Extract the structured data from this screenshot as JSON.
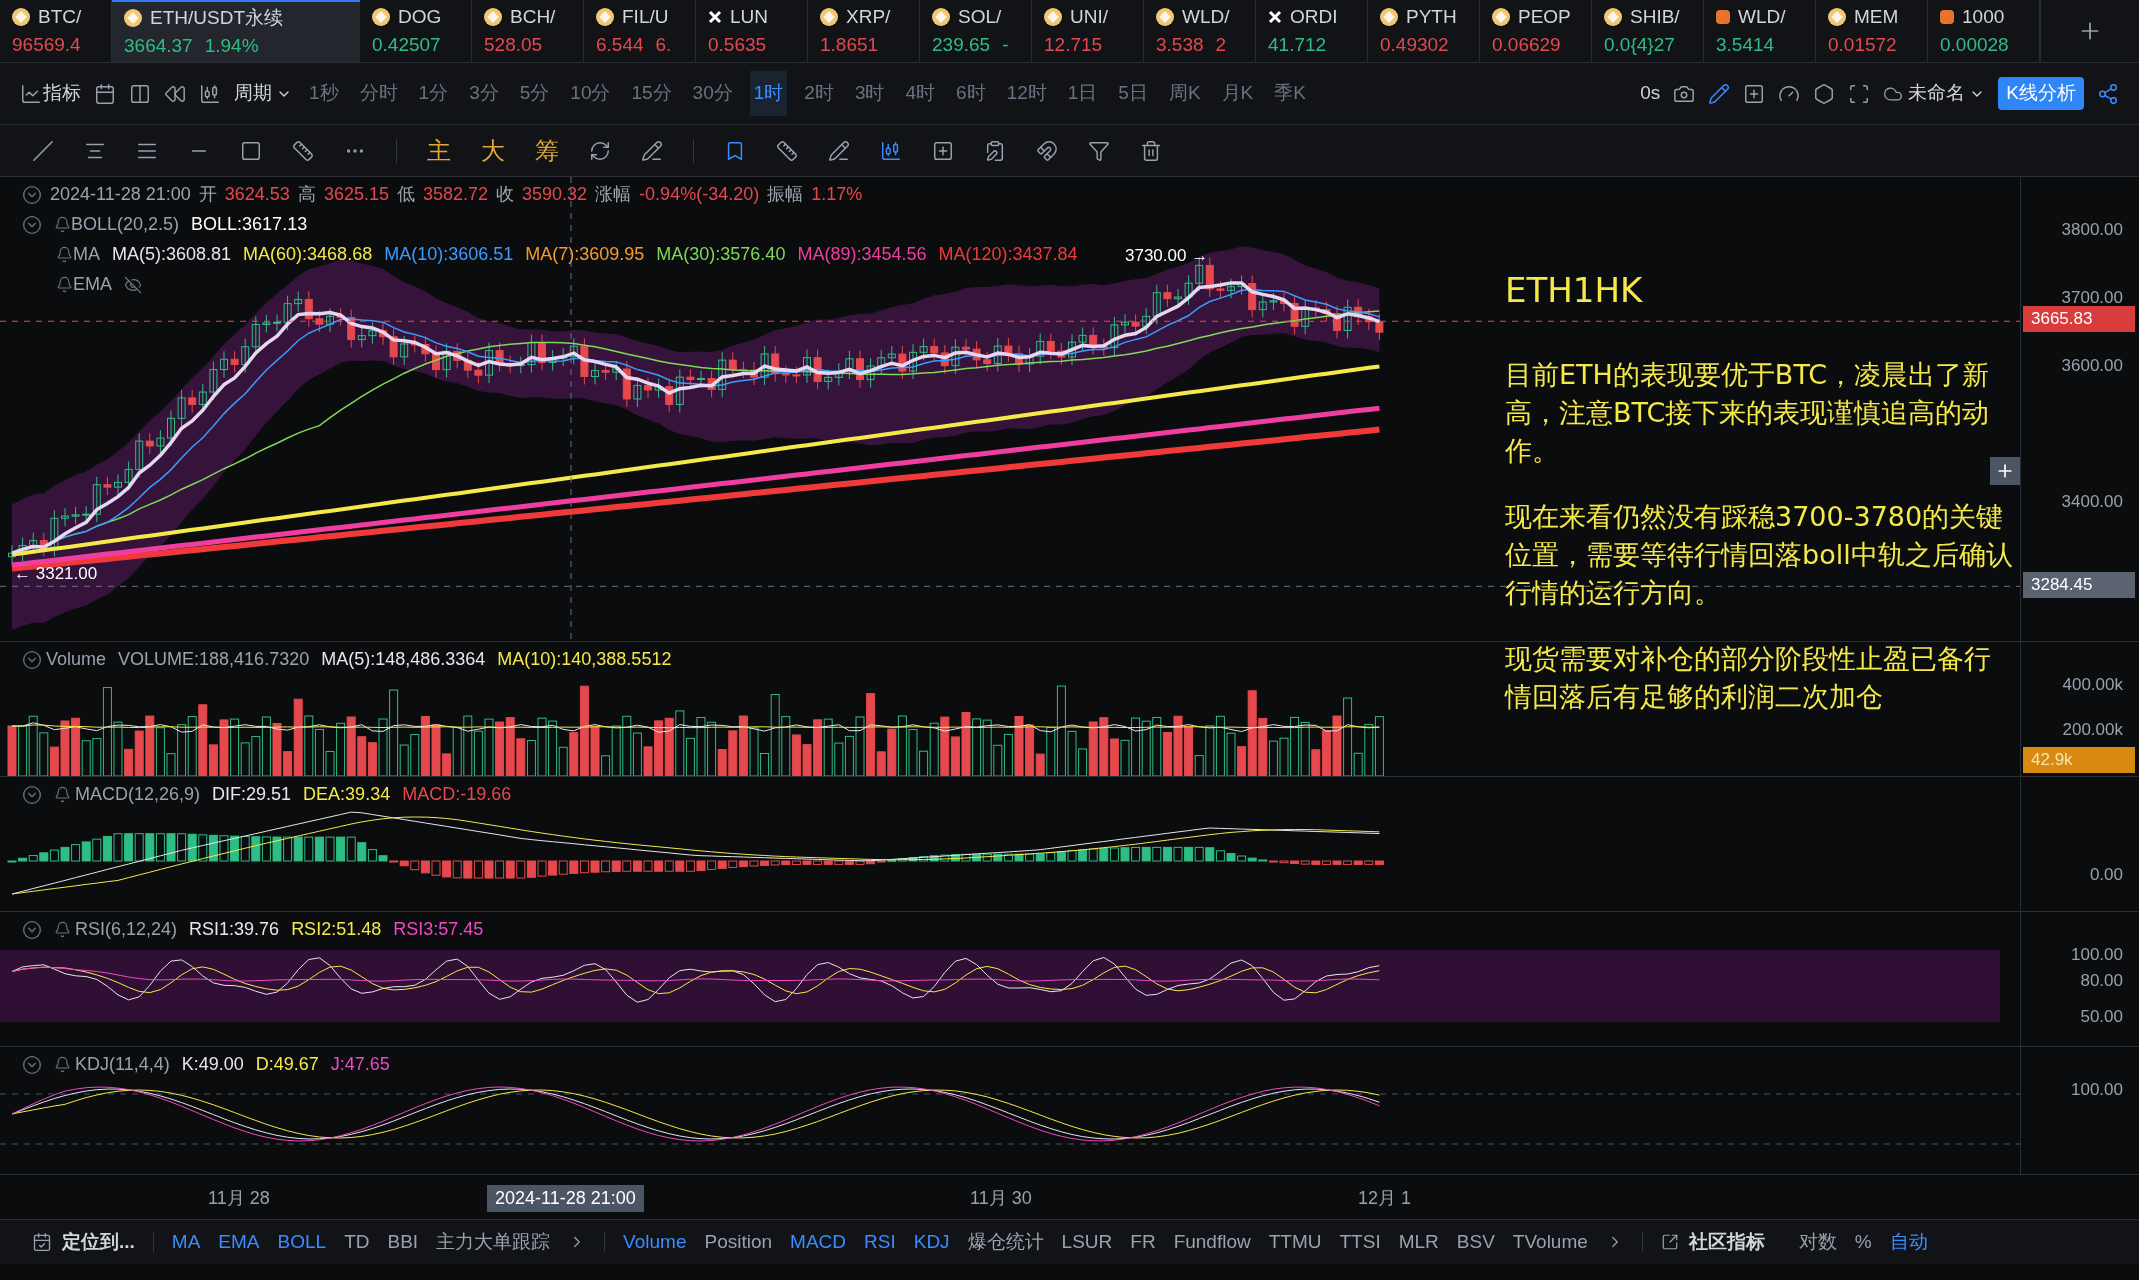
{
  "tickers": [
    {
      "symbol": "BTC/",
      "price": "96569.4",
      "rising": false,
      "kind": "coin",
      "selected": false
    },
    {
      "symbol": "ETH/USDT永续",
      "price": "3664.37",
      "change": "1.94%",
      "rising": true,
      "kind": "coin",
      "selected": true
    },
    {
      "symbol": "DOG",
      "price": "0.42507",
      "rising": true,
      "kind": "coin",
      "selected": false
    },
    {
      "symbol": "BCH/",
      "price": "528.05",
      "rising": false,
      "kind": "coin",
      "selected": false
    },
    {
      "symbol": "FIL/U",
      "price": "6.544",
      "change": "6.",
      "rising": false,
      "kind": "coin",
      "selected": false
    },
    {
      "symbol": "LUN",
      "price": "0.5635",
      "rising": false,
      "kind": "cross",
      "selected": false
    },
    {
      "symbol": "XRP/",
      "price": "1.8651",
      "rising": false,
      "kind": "coin",
      "selected": false
    },
    {
      "symbol": "SOL/",
      "price": "239.65",
      "change": "-",
      "rising": true,
      "kind": "coin",
      "selected": false
    },
    {
      "symbol": "UNI/",
      "price": "12.715",
      "rising": false,
      "kind": "coin",
      "selected": false
    },
    {
      "symbol": "WLD/",
      "price": "3.538",
      "change": "2",
      "rising": false,
      "kind": "coin",
      "selected": false
    },
    {
      "symbol": "ORDI",
      "price": "41.712",
      "rising": true,
      "kind": "cross",
      "selected": false
    },
    {
      "symbol": "PYTH",
      "price": "0.49302",
      "rising": false,
      "kind": "coin",
      "selected": false
    },
    {
      "symbol": "PEOP",
      "price": "0.06629",
      "rising": false,
      "kind": "coin",
      "selected": false
    },
    {
      "symbol": "SHIB/",
      "price": "0.0{4}27",
      "rising": true,
      "kind": "coin",
      "selected": false
    },
    {
      "symbol": "WLD/",
      "price": "3.5414",
      "rising": true,
      "kind": "square",
      "selected": false
    },
    {
      "symbol": "MEM",
      "price": "0.01572",
      "rising": false,
      "kind": "coin",
      "selected": false
    },
    {
      "symbol": "1000",
      "price": "0.00028",
      "rising": true,
      "kind": "square",
      "selected": false
    }
  ],
  "toolbar": {
    "indicators": "指标",
    "period": "周期",
    "periods": [
      {
        "label": "1秒",
        "selected": false
      },
      {
        "label": "分时",
        "selected": false
      },
      {
        "label": "1分",
        "selected": false
      },
      {
        "label": "3分",
        "selected": false
      },
      {
        "label": "5分",
        "selected": false
      },
      {
        "label": "10分",
        "selected": false
      },
      {
        "label": "15分",
        "selected": false
      },
      {
        "label": "30分",
        "selected": false
      },
      {
        "label": "1时",
        "selected": true
      },
      {
        "label": "2时",
        "selected": false
      },
      {
        "label": "3时",
        "selected": false
      },
      {
        "label": "4时",
        "selected": false
      },
      {
        "label": "6时",
        "selected": false
      },
      {
        "label": "12时",
        "selected": false
      },
      {
        "label": "1日",
        "selected": false
      },
      {
        "label": "5日",
        "selected": false
      },
      {
        "label": "周K",
        "selected": false
      },
      {
        "label": "月K",
        "selected": false
      },
      {
        "label": "季K",
        "selected": false
      }
    ],
    "countdown": "0s",
    "layout_name": "未命名",
    "analysis_button": "K线分析"
  },
  "drawing_tools": {
    "text_tools": [
      "主",
      "大",
      "筹"
    ]
  },
  "main_pane": {
    "ohlc": [
      {
        "text": "2024-11-28 21:00",
        "color": "#9ca3af"
      },
      {
        "text": "开",
        "color": "#9ca3af"
      },
      {
        "text": "3624.53",
        "color": "#e5484d"
      },
      {
        "text": "高",
        "color": "#9ca3af"
      },
      {
        "text": "3625.15",
        "color": "#e5484d"
      },
      {
        "text": "低",
        "color": "#9ca3af"
      },
      {
        "text": "3582.72",
        "color": "#e5484d"
      },
      {
        "text": "收",
        "color": "#9ca3af"
      },
      {
        "text": "3590.32",
        "color": "#e5484d"
      },
      {
        "text": "涨幅",
        "color": "#9ca3af"
      },
      {
        "text": "-0.94%(-34.20)",
        "color": "#e5484d"
      },
      {
        "text": "振幅",
        "color": "#9ca3af"
      },
      {
        "text": "1.17%",
        "color": "#e5484d"
      }
    ],
    "boll": {
      "name": "BOLL(20,2.5)",
      "value": "BOLL:3617.13"
    },
    "ma": {
      "name": "MA",
      "values": [
        {
          "text": "MA(5):3608.81",
          "color": "#e5e7eb"
        },
        {
          "text": "MA(60):3468.68",
          "color": "#f5e94a"
        },
        {
          "text": "MA(10):3606.51",
          "color": "#3b9bff"
        },
        {
          "text": "MA(7):3609.95",
          "color": "#f59a2e"
        },
        {
          "text": "MA(30):3576.40",
          "color": "#7ed957"
        },
        {
          "text": "MA(89):3454.56",
          "color": "#f03ea0"
        },
        {
          "text": "MA(120):3437.84",
          "color": "#f03a3a"
        }
      ]
    },
    "ema": {
      "name": "EMA"
    },
    "high_marker": "3730.00 →",
    "low_marker": "← 3321.00",
    "symbol_note": "ETH1HK",
    "notes": [
      "目前ETH的表现要优于BTC，凌晨出了新高，注意BTC接下来的表现谨慎追高的动作。",
      "现在来看仍然没有踩稳3700-3780的关键位置，需要等待行情回落boll中轨之后确认行情的运行方向。",
      "现货需要对补仓的部分阶段性止盈已备行情回落后有足够的利润二次加仓"
    ],
    "axis": [
      "3800.00",
      "3700.00",
      "3600.00",
      "3400.00"
    ],
    "last_price": "3665.83",
    "cursor_price": "3284.45"
  },
  "volume_pane": {
    "name": "Volume",
    "values": [
      {
        "text": "VOLUME:188,416.7320",
        "color": "#9ca3af"
      },
      {
        "text": "MA(5):148,486.3364",
        "color": "#e5e7eb"
      },
      {
        "text": "MA(10):140,388.5512",
        "color": "#f5e94a"
      }
    ],
    "axis": [
      "400.00k",
      "200.00k"
    ],
    "last": "42.9k"
  },
  "macd_pane": {
    "name": "MACD(12,26,9)",
    "values": [
      {
        "text": "DIF:29.51",
        "color": "#e5e7eb"
      },
      {
        "text": "DEA:39.34",
        "color": "#f5e94a"
      },
      {
        "text": "MACD:-19.66",
        "color": "#e5484d"
      }
    ],
    "axis": [
      "0.00"
    ]
  },
  "rsi_pane": {
    "name": "RSI(6,12,24)",
    "values": [
      {
        "text": "RSI1:39.76",
        "color": "#e5e7eb"
      },
      {
        "text": "RSI2:51.48",
        "color": "#f5e94a"
      },
      {
        "text": "RSI3:57.45",
        "color": "#f048c8"
      }
    ],
    "axis": [
      "100.00",
      "80.00",
      "50.00"
    ]
  },
  "kdj_pane": {
    "name": "KDJ(11,4,4)",
    "values": [
      {
        "text": "K:49.00",
        "color": "#e5e7eb"
      },
      {
        "text": "D:49.67",
        "color": "#f5e94a"
      },
      {
        "text": "J:47.65",
        "color": "#f048c8"
      }
    ],
    "axis": [
      "100.00"
    ]
  },
  "time_axis": [
    {
      "label": "11月 28",
      "selected": false
    },
    {
      "label": "2024-11-28 21:00",
      "selected": true
    },
    {
      "label": "11月 30",
      "selected": false
    },
    {
      "label": "12月 1",
      "selected": false
    }
  ],
  "bottom_bar": {
    "locate": "定位到...",
    "main_indicators": [
      {
        "label": "MA",
        "active": true
      },
      {
        "label": "EMA",
        "active": true
      },
      {
        "label": "BOLL",
        "active": true
      },
      {
        "label": "TD",
        "active": false
      },
      {
        "label": "BBI",
        "active": false
      },
      {
        "label": "主力大单跟踪",
        "active": false
      }
    ],
    "sub_indicators": [
      {
        "label": "Volume",
        "active": true
      },
      {
        "label": "Position",
        "active": false
      },
      {
        "label": "MACD",
        "active": true
      },
      {
        "label": "RSI",
        "active": true
      },
      {
        "label": "KDJ",
        "active": true
      },
      {
        "label": "爆仓统计",
        "active": false
      },
      {
        "label": "LSUR",
        "active": false
      },
      {
        "label": "FR",
        "active": false
      },
      {
        "label": "Fundflow",
        "active": false
      },
      {
        "label": "TTMU",
        "active": false
      },
      {
        "label": "TTSI",
        "active": false
      },
      {
        "label": "MLR",
        "active": false
      },
      {
        "label": "BSV",
        "active": false
      },
      {
        "label": "TVolume",
        "active": false
      }
    ],
    "community": "社区指标",
    "log": "对数",
    "percent": "%",
    "auto": {
      "label": "自动",
      "active": true
    }
  }
}
